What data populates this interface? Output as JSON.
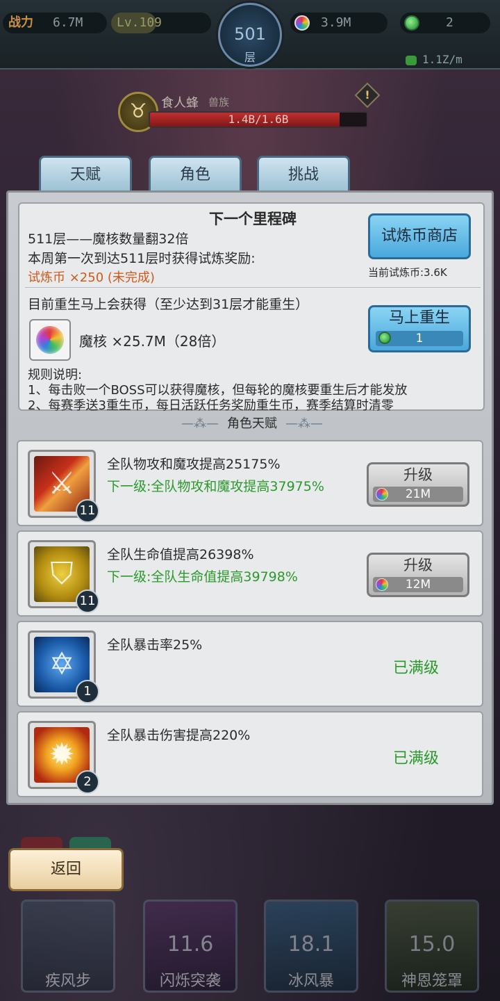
{
  "topbar": {
    "power_label": "战力",
    "power_value": "6.7M",
    "level_text": "Lv.109",
    "level_progress": 0.45,
    "floor_number": "501",
    "floor_unit": "层",
    "core_value": "3.9M",
    "gem_value": "2",
    "rate": "1.1Z/m",
    "icons": [
      "core-orb-icon",
      "gem-icon",
      "heart-icon"
    ]
  },
  "boss": {
    "name": "食人蜂",
    "race": "兽族",
    "hp_text": "1.4B/1.6B",
    "hp_fraction": 0.875,
    "warning": "!"
  },
  "tabs": [
    {
      "label": "天赋"
    },
    {
      "label": "角色"
    },
    {
      "label": "挑战"
    }
  ],
  "milestone": {
    "title": "下一个里程碑",
    "line1": "511层——魔核数量翻32倍",
    "line2": "本周第一次到达511层时获得试炼奖励:",
    "line3": "试炼币 ×250 (未完成)",
    "shop_button": "试炼币商店",
    "current_coins": "当前试炼币:3.6K",
    "rebirth_desc": "目前重生马上会获得（至少达到31层才能重生）",
    "core_reward": "魔核  ×25.7M（28倍）",
    "rebirth_button": "马上重生",
    "rebirth_cost": "1",
    "rules_title": "规则说明:",
    "rule1": "1、每击败一个BOSS可以获得魔核，但每轮的魔核要重生后才能发放",
    "rule2": "2、每赛季送3重生币，每日活跃任务奖励重生币，赛季结算时清零"
  },
  "section": {
    "title": "角色天赋",
    "ornament_left": "—⁂—",
    "ornament_right": "—⁂—"
  },
  "talents": [
    {
      "icon": "sword-icon",
      "level": "11",
      "name": "全队物攻和魔攻提高25175%",
      "next": "下一级:全队物攻和魔攻提高37975%",
      "button": "升级",
      "cost": "21M"
    },
    {
      "icon": "shield-icon",
      "level": "11",
      "name": "全队生命值提高26398%",
      "next": "下一级:全队生命值提高39798%",
      "button": "升级",
      "cost": "12M"
    },
    {
      "icon": "star-icon",
      "level": "1",
      "name": "全队暴击率25%",
      "maxed": "已满级"
    },
    {
      "icon": "burst-icon",
      "level": "2",
      "name": "全队暴击伤害提高220%",
      "maxed": "已满级"
    }
  ],
  "bottom": {
    "back_button": "返回",
    "skills": [
      {
        "name": "疾风步",
        "cooldown": ""
      },
      {
        "name": "闪烁突袭",
        "cooldown": "11.6"
      },
      {
        "name": "冰风暴",
        "cooldown": "18.1"
      },
      {
        "name": "神恩笼罩",
        "cooldown": "15.0"
      }
    ]
  }
}
